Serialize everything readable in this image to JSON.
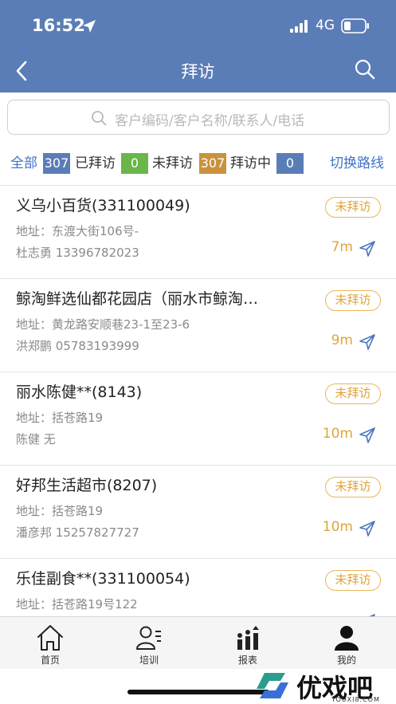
{
  "status_bar": {
    "time": "16:52",
    "network": "4G"
  },
  "header": {
    "title": "拜访"
  },
  "search": {
    "placeholder": "客户编码/客户名称/联系人/电话"
  },
  "filters": {
    "all_label": "全部",
    "all_count": "307",
    "visited_label": "已拜访",
    "visited_count": "0",
    "unvisited_label": "未拜访",
    "unvisited_count": "307",
    "visiting_label": "拜访中",
    "visiting_count": "0",
    "switch_route": "切换路线"
  },
  "colors": {
    "header_bg": "#5b7db7",
    "badge_blue": "#5b7db7",
    "badge_green": "#6ab648",
    "badge_orange": "#c9923f",
    "status_orange": "#e0a43c",
    "link_blue": "#3f72c6"
  },
  "customers": [
    {
      "name": "义乌小百货(331100049)",
      "address": "地址：东渡大街106号-",
      "contact": "杜志勇 13396782023",
      "status": "未拜访",
      "distance": "7m"
    },
    {
      "name": "鲸淘鲜选仙都花园店（丽水市鲸淘…",
      "address": "地址：黄龙路安顺巷23-1至23-6",
      "contact": "洪郑鹏 05783193999",
      "status": "未拜访",
      "distance": "9m"
    },
    {
      "name": "丽水陈健**(8143)",
      "address": "地址：括苍路19",
      "contact": "陈健 无",
      "status": "未拜访",
      "distance": "10m"
    },
    {
      "name": "好邦生活超市(8207)",
      "address": "地址：括苍路19",
      "contact": "潘彦邦 15257827727",
      "status": "未拜访",
      "distance": "10m"
    },
    {
      "name": "乐佳副食**(331100054)",
      "address": "地址：括苍路19号122",
      "contact": "",
      "status": "未拜访",
      "distance": ""
    }
  ],
  "tabbar": {
    "home": "首页",
    "training": "培训",
    "report": "报表",
    "mine": "我的"
  },
  "watermark": {
    "text": "优戏吧",
    "sub": "YOUXI8.COM"
  }
}
